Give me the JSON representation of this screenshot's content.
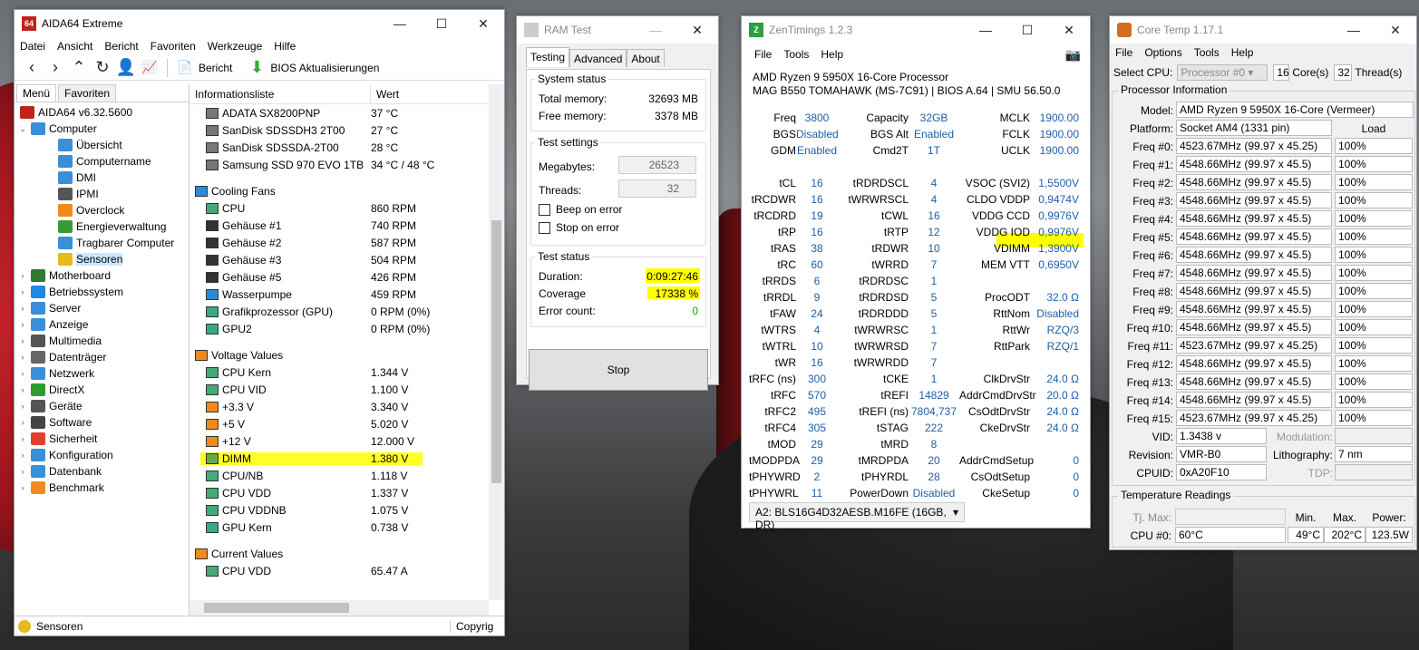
{
  "aida": {
    "title": "AIDA64 Extreme",
    "menu": [
      "Datei",
      "Ansicht",
      "Bericht",
      "Favoriten",
      "Werkzeuge",
      "Hilfe"
    ],
    "toolbar": {
      "report_label": "Bericht",
      "bios_label": "BIOS Aktualisierungen"
    },
    "tabs": [
      "Menü",
      "Favoriten"
    ],
    "tree": [
      {
        "label": "AIDA64 v6.32.5600",
        "level": 0,
        "icon": "aida-logo-icon",
        "color": "#c0231e",
        "exp": ""
      },
      {
        "label": "Computer",
        "level": 1,
        "icon": "computer-icon",
        "color": "#3b8ed8",
        "exp": "v"
      },
      {
        "label": "Übersicht",
        "level": 2,
        "icon": "monitor-icon",
        "color": "#3b8ed8",
        "exp": ""
      },
      {
        "label": "Computername",
        "level": 2,
        "icon": "monitor-icon",
        "color": "#3b8ed8",
        "exp": ""
      },
      {
        "label": "DMI",
        "level": 2,
        "icon": "chip-icon",
        "color": "#3b8ed8",
        "exp": ""
      },
      {
        "label": "IPMI",
        "level": 2,
        "icon": "device-icon",
        "color": "#555",
        "exp": ""
      },
      {
        "label": "Overclock",
        "level": 2,
        "icon": "flame-icon",
        "color": "#f08a1c",
        "exp": ""
      },
      {
        "label": "Energieverwaltung",
        "level": 2,
        "icon": "power-plug-icon",
        "color": "#3a9a3a",
        "exp": ""
      },
      {
        "label": "Tragbarer Computer",
        "level": 2,
        "icon": "laptop-icon",
        "color": "#3b8ed8",
        "exp": ""
      },
      {
        "label": "Sensoren",
        "level": 2,
        "icon": "gauge-icon",
        "color": "#e8b820",
        "exp": "",
        "selected": true
      },
      {
        "label": "Motherboard",
        "level": 1,
        "icon": "motherboard-icon",
        "color": "#2f7a2f",
        "exp": ">"
      },
      {
        "label": "Betriebssystem",
        "level": 1,
        "icon": "windows-icon",
        "color": "#1e88e5",
        "exp": ">"
      },
      {
        "label": "Server",
        "level": 1,
        "icon": "server-icon",
        "color": "#3b8ed8",
        "exp": ">"
      },
      {
        "label": "Anzeige",
        "level": 1,
        "icon": "display-icon",
        "color": "#3b8ed8",
        "exp": ">"
      },
      {
        "label": "Multimedia",
        "level": 1,
        "icon": "speaker-icon",
        "color": "#555",
        "exp": ">"
      },
      {
        "label": "Datenträger",
        "level": 1,
        "icon": "disk-icon",
        "color": "#666",
        "exp": ">"
      },
      {
        "label": "Netzwerk",
        "level": 1,
        "icon": "network-icon",
        "color": "#3b8ed8",
        "exp": ">"
      },
      {
        "label": "DirectX",
        "level": 1,
        "icon": "xbox-icon",
        "color": "#2e9d2e",
        "exp": ">"
      },
      {
        "label": "Geräte",
        "level": 1,
        "icon": "devices-icon",
        "color": "#555",
        "exp": ">"
      },
      {
        "label": "Software",
        "level": 1,
        "icon": "software-icon",
        "color": "#444",
        "exp": ">"
      },
      {
        "label": "Sicherheit",
        "level": 1,
        "icon": "shield-icon",
        "color": "#e04030",
        "exp": ">"
      },
      {
        "label": "Konfiguration",
        "level": 1,
        "icon": "config-icon",
        "color": "#3b8ed8",
        "exp": ">"
      },
      {
        "label": "Datenbank",
        "level": 1,
        "icon": "database-icon",
        "color": "#3b8ed8",
        "exp": ">"
      },
      {
        "label": "Benchmark",
        "level": 1,
        "icon": "benchmark-icon",
        "color": "#f08a1c",
        "exp": ">"
      }
    ],
    "list_header": {
      "name": "Informationsliste",
      "value": "Wert"
    },
    "list": [
      {
        "type": "row",
        "name": "ADATA SX8200PNP",
        "value": "37 °C",
        "icon": "drive-icon"
      },
      {
        "type": "row",
        "name": "SanDisk SDSSDH3 2T00",
        "value": "27 °C",
        "icon": "drive-icon"
      },
      {
        "type": "row",
        "name": "SanDisk SDSSDA-2T00",
        "value": "28 °C",
        "icon": "drive-icon"
      },
      {
        "type": "row",
        "name": "Samsung SSD 970 EVO 1TB",
        "value": "34 °C / 48 °C",
        "icon": "drive-icon"
      },
      {
        "type": "gap"
      },
      {
        "type": "group",
        "name": "Cooling Fans",
        "icon": "fan-icon"
      },
      {
        "type": "row",
        "name": "CPU",
        "value": "860 RPM",
        "icon": "cpu-icon"
      },
      {
        "type": "row",
        "name": "Gehäuse #1",
        "value": "740 RPM",
        "icon": "case-icon"
      },
      {
        "type": "row",
        "name": "Gehäuse #2",
        "value": "587 RPM",
        "icon": "case-icon"
      },
      {
        "type": "row",
        "name": "Gehäuse #3",
        "value": "504 RPM",
        "icon": "case-icon"
      },
      {
        "type": "row",
        "name": "Gehäuse #5",
        "value": "426 RPM",
        "icon": "case-icon"
      },
      {
        "type": "row",
        "name": "Wasserpumpe",
        "value": "459 RPM",
        "icon": "fan-icon"
      },
      {
        "type": "row",
        "name": "Grafikprozessor (GPU)",
        "value": "0 RPM  (0%)",
        "icon": "gpu-icon"
      },
      {
        "type": "row",
        "name": "GPU2",
        "value": "0 RPM  (0%)",
        "icon": "gpu-icon"
      },
      {
        "type": "gap"
      },
      {
        "type": "group",
        "name": "Voltage Values",
        "icon": "voltage-icon"
      },
      {
        "type": "row",
        "name": "CPU Kern",
        "value": "1.344 V",
        "icon": "cpu-icon"
      },
      {
        "type": "row",
        "name": "CPU VID",
        "value": "1.100 V",
        "icon": "cpu-icon"
      },
      {
        "type": "row",
        "name": "+3.3 V",
        "value": "3.340 V",
        "icon": "voltage-icon"
      },
      {
        "type": "row",
        "name": "+5 V",
        "value": "5.020 V",
        "icon": "voltage-icon"
      },
      {
        "type": "row",
        "name": "+12 V",
        "value": "12.000 V",
        "icon": "voltage-icon"
      },
      {
        "type": "row",
        "name": "DIMM",
        "value": "1.380 V",
        "icon": "ram-icon"
      },
      {
        "type": "row",
        "name": "CPU/NB",
        "value": "1.118 V",
        "icon": "cpu-icon"
      },
      {
        "type": "row",
        "name": "CPU VDD",
        "value": "1.337 V",
        "icon": "cpu-icon"
      },
      {
        "type": "row",
        "name": "CPU VDDNB",
        "value": "1.075 V",
        "icon": "cpu-icon"
      },
      {
        "type": "row",
        "name": "GPU Kern",
        "value": "0.738 V",
        "icon": "gpu-icon"
      },
      {
        "type": "gap"
      },
      {
        "type": "group",
        "name": "Current Values",
        "icon": "voltage-icon"
      },
      {
        "type": "row",
        "name": "CPU VDD",
        "value": "65.47 A",
        "icon": "cpu-icon"
      }
    ],
    "status_left": "Sensoren",
    "status_right": "Copyrig"
  },
  "ram": {
    "title": "RAM Test",
    "tabs": [
      "Testing",
      "Advanced",
      "About"
    ],
    "system_status": {
      "label": "System status",
      "total_label": "Total memory:",
      "total": "32693 MB",
      "free_label": "Free memory:",
      "free": "3378 MB"
    },
    "settings": {
      "label": "Test settings",
      "mb_label": "Megabytes:",
      "mb": "26523",
      "threads_label": "Threads:",
      "threads": "32",
      "beep": "Beep on error",
      "stop": "Stop on error"
    },
    "test_status": {
      "label": "Test status",
      "duration_label": "Duration:",
      "duration": "0:09:27:46",
      "coverage_label": "Coverage",
      "coverage": "17338 %",
      "errors_label": "Error count:",
      "errors": "0"
    },
    "stop_button": "Stop"
  },
  "zen": {
    "title": "ZenTimings 1.2.3",
    "menu": [
      "File",
      "Tools",
      "Help"
    ],
    "cpu": "AMD Ryzen 9 5950X 16-Core Processor",
    "board": "MAG B550 TOMAHAWK (MS-7C91) | BIOS A.64 | SMU 56.50.0",
    "rows": [
      [
        "Freq",
        "3800",
        "Capacity",
        "32GB",
        "MCLK",
        "1900.00"
      ],
      [
        "BGS",
        "Disabled",
        "BGS Alt",
        "Enabled",
        "FCLK",
        "1900.00"
      ],
      [
        "GDM",
        "Enabled",
        "Cmd2T",
        "1T",
        "UCLK",
        "1900.00"
      ],
      [
        "",
        "",
        "",
        "",
        "",
        ""
      ],
      [
        "tCL",
        "16",
        "tRDRDSCL",
        "4",
        "VSOC (SVI2)",
        "1,5500V"
      ],
      [
        "tRCDWR",
        "16",
        "tWRWRSCL",
        "4",
        "CLDO VDDP",
        "0,9474V"
      ],
      [
        "tRCDRD",
        "19",
        "tCWL",
        "16",
        "VDDG CCD",
        "0,9976V"
      ],
      [
        "tRP",
        "16",
        "tRTP",
        "12",
        "VDDG IOD",
        "0,9976V"
      ],
      [
        "tRAS",
        "38",
        "tRDWR",
        "10",
        "VDIMM",
        "1,3900V"
      ],
      [
        "tRC",
        "60",
        "tWRRD",
        "7",
        "MEM VTT",
        "0,6950V"
      ],
      [
        "tRRDS",
        "6",
        "tRDRDSC",
        "1",
        "",
        ""
      ],
      [
        "tRRDL",
        "9",
        "tRDRDSD",
        "5",
        "ProcODT",
        "32.0 Ω"
      ],
      [
        "tFAW",
        "24",
        "tRDRDDD",
        "5",
        "RttNom",
        "Disabled"
      ],
      [
        "tWTRS",
        "4",
        "tWRWRSC",
        "1",
        "RttWr",
        "RZQ/3"
      ],
      [
        "tWTRL",
        "10",
        "tWRWRSD",
        "7",
        "RttPark",
        "RZQ/1"
      ],
      [
        "tWR",
        "16",
        "tWRWRDD",
        "7",
        "",
        ""
      ],
      [
        "tRFC (ns)",
        "300",
        "tCKE",
        "1",
        "ClkDrvStr",
        "24.0 Ω"
      ],
      [
        "tRFC",
        "570",
        "tREFI",
        "14829",
        "AddrCmdDrvStr",
        "20.0 Ω"
      ],
      [
        "tRFC2",
        "495",
        "tREFI (ns)",
        "7804,737",
        "CsOdtDrvStr",
        "24.0 Ω"
      ],
      [
        "tRFC4",
        "305",
        "tSTAG",
        "222",
        "CkeDrvStr",
        "24.0 Ω"
      ],
      [
        "tMOD",
        "29",
        "tMRD",
        "8",
        "",
        ""
      ],
      [
        "tMODPDA",
        "29",
        "tMRDPDA",
        "20",
        "AddrCmdSetup",
        "0"
      ],
      [
        "tPHYWRD",
        "2",
        "tPHYRDL",
        "28",
        "CsOdtSetup",
        "0"
      ],
      [
        "tPHYWRL",
        "11",
        "PowerDown",
        "Disabled",
        "CkeSetup",
        "0"
      ]
    ],
    "module": "A2: BLS16G4D32AESB.M16FE (16GB, DR)"
  },
  "core": {
    "title": "Core Temp 1.17.1",
    "menu": [
      "File",
      "Options",
      "Tools",
      "Help"
    ],
    "select_cpu_label": "Select CPU:",
    "processor": "Processor #0",
    "cores": "16",
    "cores_label": "Core(s)",
    "threads": "32",
    "threads_label": "Thread(s)",
    "info_label": "Processor Information",
    "model_label": "Model:",
    "model": "AMD Ryzen 9 5950X 16-Core (Vermeer)",
    "platform_label": "Platform:",
    "platform": "Socket AM4 (1331 pin)",
    "load_label": "Load",
    "freqs": [
      [
        "Freq #0:",
        "4523.67MHz (99.97 x 45.25)",
        "100%"
      ],
      [
        "Freq #1:",
        "4548.66MHz (99.97 x 45.5)",
        "100%"
      ],
      [
        "Freq #2:",
        "4548.66MHz (99.97 x 45.5)",
        "100%"
      ],
      [
        "Freq #3:",
        "4548.66MHz (99.97 x 45.5)",
        "100%"
      ],
      [
        "Freq #4:",
        "4548.66MHz (99.97 x 45.5)",
        "100%"
      ],
      [
        "Freq #5:",
        "4548.66MHz (99.97 x 45.5)",
        "100%"
      ],
      [
        "Freq #6:",
        "4548.66MHz (99.97 x 45.5)",
        "100%"
      ],
      [
        "Freq #7:",
        "4548.66MHz (99.97 x 45.5)",
        "100%"
      ],
      [
        "Freq #8:",
        "4548.66MHz (99.97 x 45.5)",
        "100%"
      ],
      [
        "Freq #9:",
        "4548.66MHz (99.97 x 45.5)",
        "100%"
      ],
      [
        "Freq #10:",
        "4548.66MHz (99.97 x 45.5)",
        "100%"
      ],
      [
        "Freq #11:",
        "4523.67MHz (99.97 x 45.25)",
        "100%"
      ],
      [
        "Freq #12:",
        "4548.66MHz (99.97 x 45.5)",
        "100%"
      ],
      [
        "Freq #13:",
        "4548.66MHz (99.97 x 45.5)",
        "100%"
      ],
      [
        "Freq #14:",
        "4548.66MHz (99.97 x 45.5)",
        "100%"
      ],
      [
        "Freq #15:",
        "4523.67MHz (99.97 x 45.25)",
        "100%"
      ]
    ],
    "vid_label": "VID:",
    "vid": "1.3438 v",
    "modulation_label": "Modulation:",
    "revision_label": "Revision:",
    "revision": "VMR-B0",
    "litho_label": "Lithography:",
    "litho": "7 nm",
    "cpuid_label": "CPUID:",
    "cpuid": "0xA20F10",
    "tdp_label": "TDP:",
    "temp_label": "Temperature Readings",
    "tjmax_label": "Tj. Max:",
    "min_label": "Min.",
    "max_label": "Max.",
    "power_label": "Power:",
    "cpu0_label": "CPU #0:",
    "cpu0": "60°C",
    "cpu0_min": "49°C",
    "cpu0_max": "202°C",
    "cpu0_power": "123.5W"
  }
}
